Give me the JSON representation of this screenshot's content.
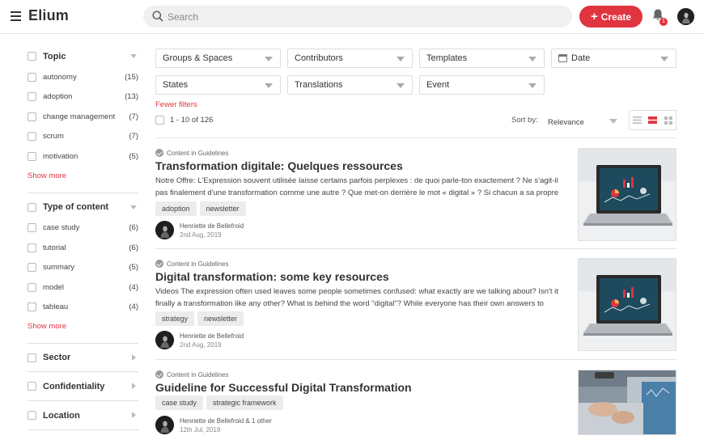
{
  "app": {
    "brand": "Elium"
  },
  "header": {
    "search_placeholder": "Search",
    "create_label": "Create",
    "notification_count": "1"
  },
  "sidebar": {
    "topic": {
      "title": "Topic",
      "items": [
        {
          "label": "autonomy",
          "count": "(15)"
        },
        {
          "label": "adoption",
          "count": "(13)"
        },
        {
          "label": "change management",
          "count": "(7)"
        },
        {
          "label": "scrum",
          "count": "(7)"
        },
        {
          "label": "motivation",
          "count": "(5)"
        }
      ],
      "show_more": "Show more"
    },
    "type_of_content": {
      "title": "Type of content",
      "items": [
        {
          "label": "case study",
          "count": "(6)"
        },
        {
          "label": "tutorial",
          "count": "(6)"
        },
        {
          "label": "summary",
          "count": "(5)"
        },
        {
          "label": "model",
          "count": "(4)"
        },
        {
          "label": "tableau",
          "count": "(4)"
        }
      ],
      "show_more": "Show more"
    },
    "collapsed": [
      {
        "title": "Sector"
      },
      {
        "title": "Confidentiality"
      },
      {
        "title": "Location"
      }
    ]
  },
  "filters": {
    "groups_spaces": "Groups & Spaces",
    "contributors": "Contributors",
    "templates": "Templates",
    "date": "Date",
    "states": "States",
    "translations": "Translations",
    "event": "Event",
    "fewer_filters": "Fewer filters"
  },
  "results_bar": {
    "count": "1 - 10 of 126",
    "sort_label": "Sort by:",
    "sort_value": "Relevance"
  },
  "results": [
    {
      "crumb": "Content in Guidelines",
      "title": "Transformation digitale: Quelques ressources",
      "excerpt": "Notre Offre: L'Expression souvent utilisée laisse certains parfois perplexes : de quoi parle-ton exactement ? Ne s'agit-il pas finalement d'une transformation comme une autre ? Que met-on derrière le mot « digital » ? Si chacun a sa propre réponse...",
      "tags": [
        "adoption",
        "newsletter"
      ],
      "author": "Henriette de Bellefroid",
      "date": "2nd Aug, 2019"
    },
    {
      "crumb": "Content in Guidelines",
      "title": "Digital transformation: some key resources",
      "excerpt": "Videos The expression often used leaves some people sometimes confused: what exactly are we talking about? Isn't it finally a transformation like any other? What is behind the word \"digital\"? While everyone has their own answers to these...",
      "tags": [
        "strategy",
        "newsletter"
      ],
      "author": "Henriette de Bellefroid",
      "date": "2nd Aug, 2019"
    },
    {
      "crumb": "Content in Guidelines",
      "title": "Guideline for Successful Digital Transformation",
      "excerpt": "",
      "tags": [
        "case study",
        "strategic framework"
      ],
      "author": "Henriette de Bellefroid & 1 other",
      "date": "12th Jul, 2019"
    }
  ],
  "colors": {
    "accent": "#e0343f",
    "text": "#333333",
    "border": "#dddddd"
  }
}
